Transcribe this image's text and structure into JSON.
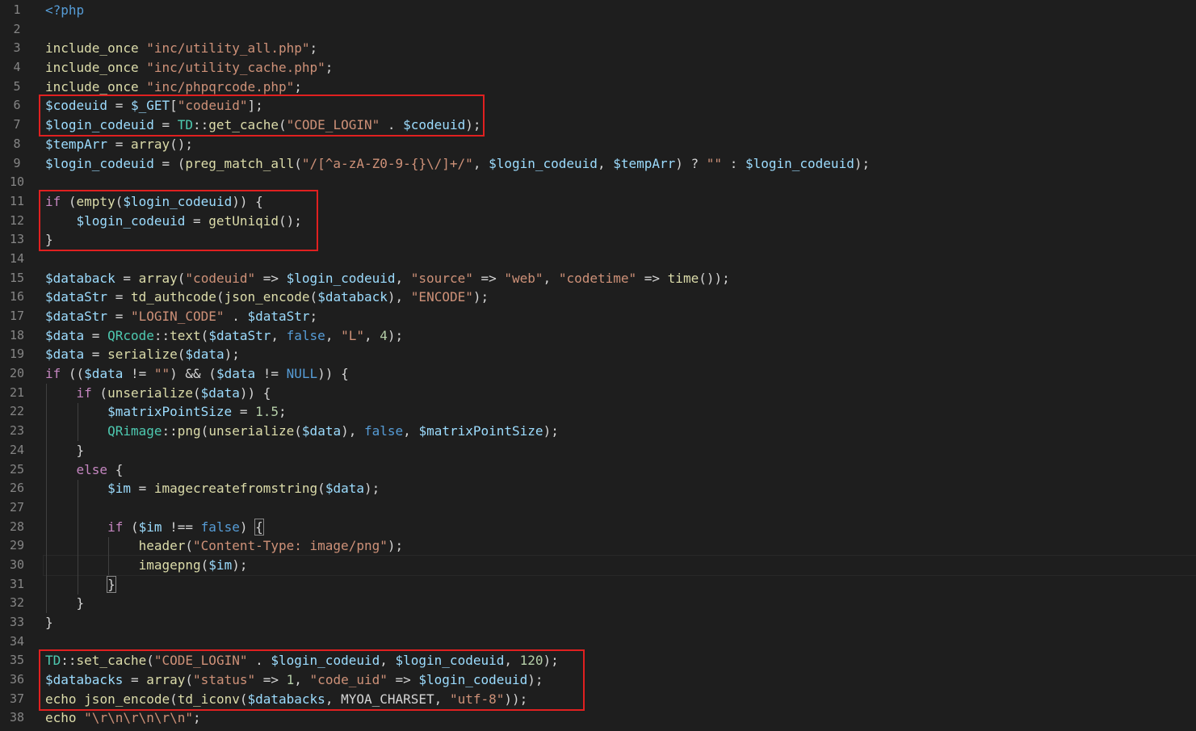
{
  "editor": {
    "language": "php",
    "highlight_color": "#e02020",
    "current_line": 30,
    "lines": [
      {
        "n": "1",
        "tokens": [
          [
            "tag",
            "<?php"
          ]
        ]
      },
      {
        "n": "2",
        "tokens": []
      },
      {
        "n": "3",
        "tokens": [
          [
            "fn",
            "include_once"
          ],
          [
            "plain",
            " "
          ],
          [
            "str",
            "\"inc/utility_all.php\""
          ],
          [
            "plain",
            ";"
          ]
        ]
      },
      {
        "n": "4",
        "tokens": [
          [
            "fn",
            "include_once"
          ],
          [
            "plain",
            " "
          ],
          [
            "str",
            "\"inc/utility_cache.php\""
          ],
          [
            "plain",
            ";"
          ]
        ]
      },
      {
        "n": "5",
        "tokens": [
          [
            "fn",
            "include_once"
          ],
          [
            "plain",
            " "
          ],
          [
            "str",
            "\"inc/phpqrcode.php\""
          ],
          [
            "plain",
            ";"
          ]
        ]
      },
      {
        "n": "6",
        "tokens": [
          [
            "var",
            "$codeuid"
          ],
          [
            "plain",
            " = "
          ],
          [
            "var",
            "$_GET"
          ],
          [
            "plain",
            "["
          ],
          [
            "str",
            "\"codeuid\""
          ],
          [
            "plain",
            "];"
          ]
        ]
      },
      {
        "n": "7",
        "tokens": [
          [
            "var",
            "$login_codeuid"
          ],
          [
            "plain",
            " = "
          ],
          [
            "class",
            "TD"
          ],
          [
            "plain",
            "::"
          ],
          [
            "fn",
            "get_cache"
          ],
          [
            "plain",
            "("
          ],
          [
            "str",
            "\"CODE_LOGIN\""
          ],
          [
            "plain",
            " . "
          ],
          [
            "var",
            "$codeuid"
          ],
          [
            "plain",
            ");"
          ]
        ]
      },
      {
        "n": "8",
        "tokens": [
          [
            "var",
            "$tempArr"
          ],
          [
            "plain",
            " = "
          ],
          [
            "fn",
            "array"
          ],
          [
            "plain",
            "();"
          ]
        ]
      },
      {
        "n": "9",
        "tokens": [
          [
            "var",
            "$login_codeuid"
          ],
          [
            "plain",
            " = ("
          ],
          [
            "fn",
            "preg_match_all"
          ],
          [
            "plain",
            "("
          ],
          [
            "str",
            "\"/[^a-zA-Z0-9-{}\\/]+/\""
          ],
          [
            "plain",
            ", "
          ],
          [
            "var",
            "$login_codeuid"
          ],
          [
            "plain",
            ", "
          ],
          [
            "var",
            "$tempArr"
          ],
          [
            "plain",
            ") ? "
          ],
          [
            "str",
            "\"\""
          ],
          [
            "plain",
            " : "
          ],
          [
            "var",
            "$login_codeuid"
          ],
          [
            "plain",
            ");"
          ]
        ]
      },
      {
        "n": "10",
        "tokens": []
      },
      {
        "n": "11",
        "tokens": [
          [
            "kw",
            "if"
          ],
          [
            "plain",
            " ("
          ],
          [
            "fn",
            "empty"
          ],
          [
            "plain",
            "("
          ],
          [
            "var",
            "$login_codeuid"
          ],
          [
            "plain",
            ")) {"
          ]
        ]
      },
      {
        "n": "12",
        "tokens": [
          [
            "plain",
            "    "
          ],
          [
            "var",
            "$login_codeuid"
          ],
          [
            "plain",
            " = "
          ],
          [
            "fn",
            "getUniqid"
          ],
          [
            "plain",
            "();"
          ]
        ]
      },
      {
        "n": "13",
        "tokens": [
          [
            "plain",
            "}"
          ]
        ]
      },
      {
        "n": "14",
        "tokens": []
      },
      {
        "n": "15",
        "tokens": [
          [
            "var",
            "$databack"
          ],
          [
            "plain",
            " = "
          ],
          [
            "fn",
            "array"
          ],
          [
            "plain",
            "("
          ],
          [
            "str",
            "\"codeuid\""
          ],
          [
            "plain",
            " => "
          ],
          [
            "var",
            "$login_codeuid"
          ],
          [
            "plain",
            ", "
          ],
          [
            "str",
            "\"source\""
          ],
          [
            "plain",
            " => "
          ],
          [
            "str",
            "\"web\""
          ],
          [
            "plain",
            ", "
          ],
          [
            "str",
            "\"codetime\""
          ],
          [
            "plain",
            " => "
          ],
          [
            "fn",
            "time"
          ],
          [
            "plain",
            "());"
          ]
        ]
      },
      {
        "n": "16",
        "tokens": [
          [
            "var",
            "$dataStr"
          ],
          [
            "plain",
            " = "
          ],
          [
            "fn",
            "td_authcode"
          ],
          [
            "plain",
            "("
          ],
          [
            "fn",
            "json_encode"
          ],
          [
            "plain",
            "("
          ],
          [
            "var",
            "$databack"
          ],
          [
            "plain",
            "), "
          ],
          [
            "str",
            "\"ENCODE\""
          ],
          [
            "plain",
            ");"
          ]
        ]
      },
      {
        "n": "17",
        "tokens": [
          [
            "var",
            "$dataStr"
          ],
          [
            "plain",
            " = "
          ],
          [
            "str",
            "\"LOGIN_CODE\""
          ],
          [
            "plain",
            " . "
          ],
          [
            "var",
            "$dataStr"
          ],
          [
            "plain",
            ";"
          ]
        ]
      },
      {
        "n": "18",
        "tokens": [
          [
            "var",
            "$data"
          ],
          [
            "plain",
            " = "
          ],
          [
            "class",
            "QRcode"
          ],
          [
            "plain",
            "::"
          ],
          [
            "fn",
            "text"
          ],
          [
            "plain",
            "("
          ],
          [
            "var",
            "$dataStr"
          ],
          [
            "plain",
            ", "
          ],
          [
            "const",
            "false"
          ],
          [
            "plain",
            ", "
          ],
          [
            "str",
            "\"L\""
          ],
          [
            "plain",
            ", "
          ],
          [
            "num",
            "4"
          ],
          [
            "plain",
            ");"
          ]
        ]
      },
      {
        "n": "19",
        "tokens": [
          [
            "var",
            "$data"
          ],
          [
            "plain",
            " = "
          ],
          [
            "fn",
            "serialize"
          ],
          [
            "plain",
            "("
          ],
          [
            "var",
            "$data"
          ],
          [
            "plain",
            ");"
          ]
        ]
      },
      {
        "n": "20",
        "tokens": [
          [
            "kw",
            "if"
          ],
          [
            "plain",
            " (("
          ],
          [
            "var",
            "$data"
          ],
          [
            "plain",
            " != "
          ],
          [
            "str",
            "\"\""
          ],
          [
            "plain",
            ") && ("
          ],
          [
            "var",
            "$data"
          ],
          [
            "plain",
            " != "
          ],
          [
            "const",
            "NULL"
          ],
          [
            "plain",
            ")) {"
          ]
        ]
      },
      {
        "n": "21",
        "tokens": [
          [
            "plain",
            "    "
          ],
          [
            "kw",
            "if"
          ],
          [
            "plain",
            " ("
          ],
          [
            "fn",
            "unserialize"
          ],
          [
            "plain",
            "("
          ],
          [
            "var",
            "$data"
          ],
          [
            "plain",
            ")) {"
          ]
        ]
      },
      {
        "n": "22",
        "tokens": [
          [
            "plain",
            "        "
          ],
          [
            "var",
            "$matrixPointSize"
          ],
          [
            "plain",
            " = "
          ],
          [
            "num",
            "1.5"
          ],
          [
            "plain",
            ";"
          ]
        ]
      },
      {
        "n": "23",
        "tokens": [
          [
            "plain",
            "        "
          ],
          [
            "class",
            "QRimage"
          ],
          [
            "plain",
            "::"
          ],
          [
            "fn",
            "png"
          ],
          [
            "plain",
            "("
          ],
          [
            "fn",
            "unserialize"
          ],
          [
            "plain",
            "("
          ],
          [
            "var",
            "$data"
          ],
          [
            "plain",
            "), "
          ],
          [
            "const",
            "false"
          ],
          [
            "plain",
            ", "
          ],
          [
            "var",
            "$matrixPointSize"
          ],
          [
            "plain",
            ");"
          ]
        ]
      },
      {
        "n": "24",
        "tokens": [
          [
            "plain",
            "    }"
          ]
        ]
      },
      {
        "n": "25",
        "tokens": [
          [
            "plain",
            "    "
          ],
          [
            "kw",
            "else"
          ],
          [
            "plain",
            " {"
          ]
        ]
      },
      {
        "n": "26",
        "tokens": [
          [
            "plain",
            "        "
          ],
          [
            "var",
            "$im"
          ],
          [
            "plain",
            " = "
          ],
          [
            "fn",
            "imagecreatefromstring"
          ],
          [
            "plain",
            "("
          ],
          [
            "var",
            "$data"
          ],
          [
            "plain",
            ");"
          ]
        ]
      },
      {
        "n": "27",
        "tokens": []
      },
      {
        "n": "28",
        "tokens": [
          [
            "plain",
            "        "
          ],
          [
            "kw",
            "if"
          ],
          [
            "plain",
            " ("
          ],
          [
            "var",
            "$im"
          ],
          [
            "plain",
            " !== "
          ],
          [
            "const",
            "false"
          ],
          [
            "plain",
            ") "
          ],
          [
            "brk",
            "{"
          ]
        ]
      },
      {
        "n": "29",
        "tokens": [
          [
            "plain",
            "            "
          ],
          [
            "fn",
            "header"
          ],
          [
            "plain",
            "("
          ],
          [
            "str",
            "\"Content-Type: image/png\""
          ],
          [
            "plain",
            ");"
          ]
        ]
      },
      {
        "n": "30",
        "tokens": [
          [
            "plain",
            "            "
          ],
          [
            "fn",
            "imagepng"
          ],
          [
            "plain",
            "("
          ],
          [
            "var",
            "$im"
          ],
          [
            "plain",
            ");"
          ]
        ]
      },
      {
        "n": "31",
        "tokens": [
          [
            "plain",
            "        "
          ],
          [
            "brk",
            "}"
          ]
        ]
      },
      {
        "n": "32",
        "tokens": [
          [
            "plain",
            "    }"
          ]
        ]
      },
      {
        "n": "33",
        "tokens": [
          [
            "plain",
            "}"
          ]
        ]
      },
      {
        "n": "34",
        "tokens": []
      },
      {
        "n": "35",
        "tokens": [
          [
            "class",
            "TD"
          ],
          [
            "plain",
            "::"
          ],
          [
            "fn",
            "set_cache"
          ],
          [
            "plain",
            "("
          ],
          [
            "str",
            "\"CODE_LOGIN\""
          ],
          [
            "plain",
            " . "
          ],
          [
            "var",
            "$login_codeuid"
          ],
          [
            "plain",
            ", "
          ],
          [
            "var",
            "$login_codeuid"
          ],
          [
            "plain",
            ", "
          ],
          [
            "num",
            "120"
          ],
          [
            "plain",
            ");"
          ]
        ]
      },
      {
        "n": "36",
        "tokens": [
          [
            "var",
            "$databacks"
          ],
          [
            "plain",
            " = "
          ],
          [
            "fn",
            "array"
          ],
          [
            "plain",
            "("
          ],
          [
            "str",
            "\"status\""
          ],
          [
            "plain",
            " => "
          ],
          [
            "num",
            "1"
          ],
          [
            "plain",
            ", "
          ],
          [
            "str",
            "\"code_uid\""
          ],
          [
            "plain",
            " => "
          ],
          [
            "var",
            "$login_codeuid"
          ],
          [
            "plain",
            ");"
          ]
        ]
      },
      {
        "n": "37",
        "tokens": [
          [
            "fn",
            "echo"
          ],
          [
            "plain",
            " "
          ],
          [
            "fn",
            "json_encode"
          ],
          [
            "plain",
            "("
          ],
          [
            "fn",
            "td_iconv"
          ],
          [
            "plain",
            "("
          ],
          [
            "var",
            "$databacks"
          ],
          [
            "plain",
            ", "
          ],
          [
            "plain",
            "MYOA_CHARSET"
          ],
          [
            "plain",
            ", "
          ],
          [
            "str",
            "\"utf-8\""
          ],
          [
            "plain",
            "));"
          ]
        ]
      },
      {
        "n": "38",
        "tokens": [
          [
            "fn",
            "echo"
          ],
          [
            "plain",
            " "
          ],
          [
            "str",
            "\"\\r\\n\\r\\n\\r\\n\""
          ],
          [
            "plain",
            ";"
          ]
        ]
      }
    ],
    "highlight_boxes": [
      {
        "name": "highlight-box-codeuid",
        "from_line": 6,
        "to_line": 7
      },
      {
        "name": "highlight-box-empty-check",
        "from_line": 11,
        "to_line": 13
      },
      {
        "name": "highlight-box-set-cache",
        "from_line": 35,
        "to_line": 37
      }
    ]
  }
}
